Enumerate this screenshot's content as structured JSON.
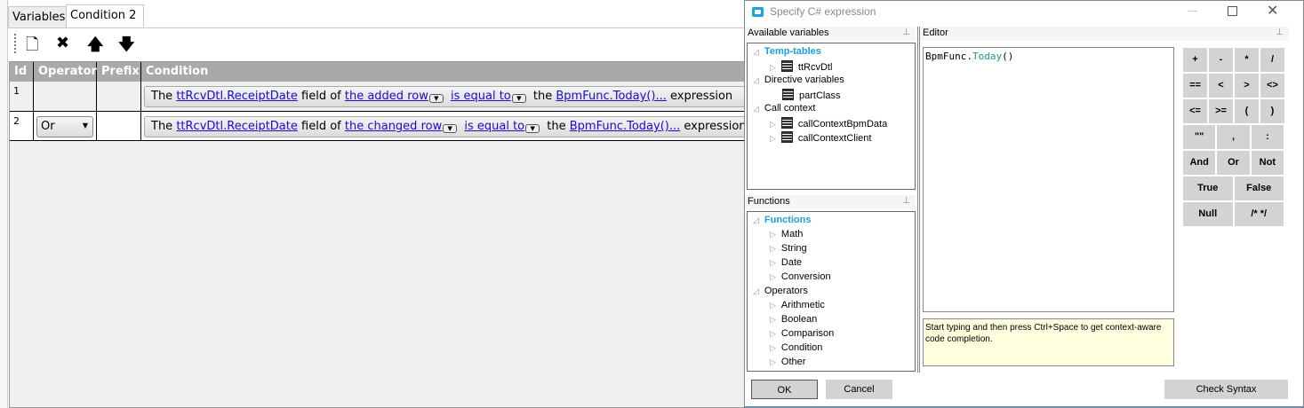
{
  "tabs": [
    {
      "label": "Variables"
    },
    {
      "label": "Condition 2"
    }
  ],
  "toolbar": {
    "new": "🗋",
    "delete": "✖",
    "up": "🡅",
    "down": "🡇"
  },
  "grid": {
    "headers": [
      "Id",
      "Operator",
      "Prefix",
      "Condition"
    ],
    "rows": [
      {
        "id": "1",
        "operator": "",
        "prefix": "",
        "parts": {
          "the": "The",
          "field": "ttRcvDtl.ReceiptDate",
          "of": "field of",
          "row": "the added row",
          "op": "is equal to",
          "the2": "the",
          "expr": "BpmFunc.Today()...",
          "end": "expression"
        }
      },
      {
        "id": "2",
        "operator": "Or",
        "prefix": "",
        "parts": {
          "the": "The",
          "field": "ttRcvDtl.ReceiptDate",
          "of": "field of",
          "row": "the changed row",
          "op": "is equal to",
          "the2": "the",
          "expr": "BpmFunc.Today()...",
          "end": "expression"
        }
      }
    ]
  },
  "dialog": {
    "title": "Specify C# expression",
    "vars_header": "Available variables",
    "editor_header": "Editor",
    "functions_header": "Functions",
    "vars_tree": [
      "Temp-tables",
      "ttRcvDtl",
      "Directive variables",
      "partClass",
      "Call context",
      "callContextBpmData",
      "callContextClient"
    ],
    "func_tree": [
      "Functions",
      "Math",
      "String",
      "Date",
      "Conversion",
      "Operators",
      "Arithmetic",
      "Boolean",
      "Comparison",
      "Condition",
      "Other"
    ],
    "code_obj": "BpmFunc.",
    "code_method": "Today",
    "code_paren": "()",
    "hint": "Start typing and then press Ctrl+Space to get context-aware code completion.",
    "keys": [
      "+",
      "-",
      "*",
      "/",
      "==",
      "<",
      ">",
      "<>",
      "<=",
      ">=",
      "(",
      ")",
      "\"\"",
      ",",
      ":",
      "And",
      "Or",
      "Not",
      "True",
      "False",
      "Null",
      "/* */"
    ],
    "ok": "OK",
    "cancel": "Cancel",
    "check": "Check Syntax"
  }
}
